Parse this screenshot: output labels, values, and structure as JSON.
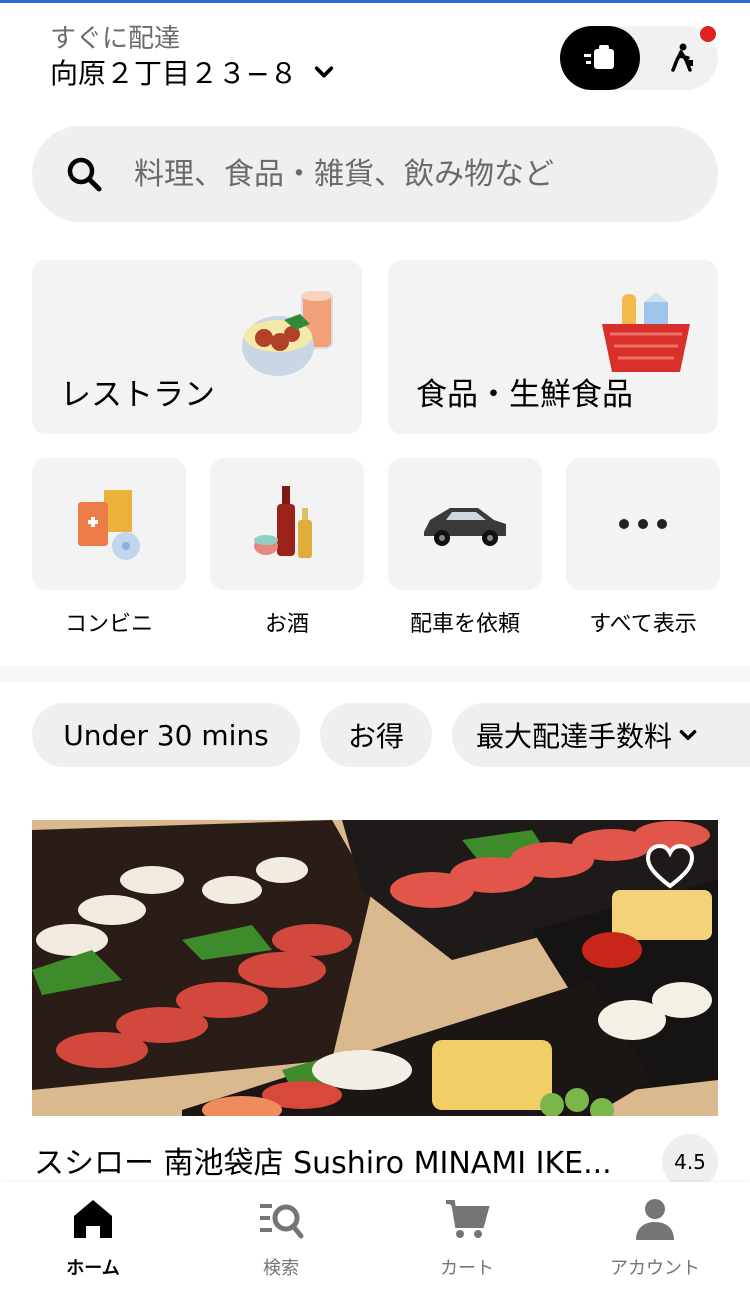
{
  "header": {
    "mode_label": "すぐに配達",
    "address": "向原２丁目２３−８",
    "delivery_mode_icon": "delivery-icon",
    "pickup_mode_icon": "pickup-walk-icon"
  },
  "search": {
    "placeholder": "料理、食品・雑貨、飲み物など"
  },
  "categories_large": [
    {
      "label": "レストラン",
      "icon": "restaurant-bowl-icon"
    },
    {
      "label": "食品・生鮮食品",
      "icon": "grocery-basket-icon"
    }
  ],
  "categories_small": [
    {
      "label": "コンビニ",
      "icon": "convenience-store-icon"
    },
    {
      "label": "お酒",
      "icon": "alcohol-bottles-icon"
    },
    {
      "label": "配車を依頼",
      "icon": "car-icon"
    },
    {
      "label": "すべて表示",
      "icon": "more-dots-icon"
    }
  ],
  "filters": [
    {
      "label": "Under 30 mins"
    },
    {
      "label": "お得"
    },
    {
      "label": "最大配達手数料"
    }
  ],
  "store": {
    "name": "スシロー 南池袋店 Sushiro MINAMI IKE...",
    "rating": "4.5"
  },
  "bottom_nav": [
    {
      "label": "ホーム",
      "icon": "home-icon",
      "active": true
    },
    {
      "label": "検索",
      "icon": "search-list-icon",
      "active": false
    },
    {
      "label": "カート",
      "icon": "cart-icon",
      "active": false
    },
    {
      "label": "アカウント",
      "icon": "account-icon",
      "active": false
    }
  ],
  "colors": {
    "accent": "#000000",
    "notification": "#e02020",
    "tile_bg": "#f3f3f3",
    "chip_bg": "#efefef"
  }
}
